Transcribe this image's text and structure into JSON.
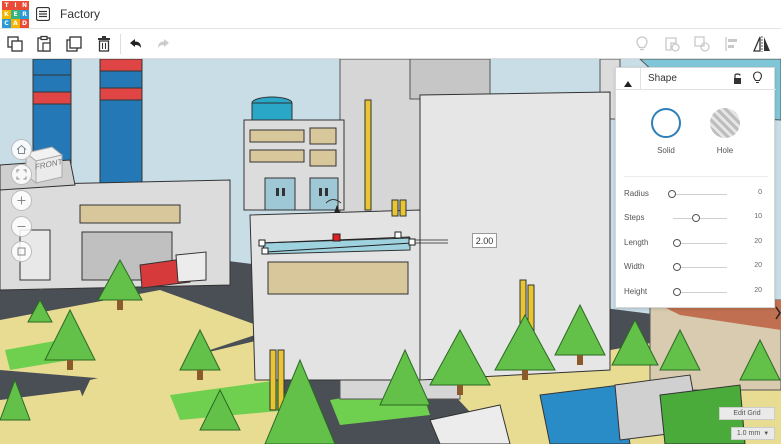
{
  "app": {
    "logo_letters": [
      "T",
      "I",
      "N",
      "K",
      "E",
      "R",
      "C",
      "A",
      "D"
    ],
    "logo_colors": [
      "#e94b36",
      "#e94b36",
      "#e94b36",
      "#f4b400",
      "#36b37e",
      "#2a9bd6",
      "#2a9bd6",
      "#f4b400",
      "#e94b36"
    ],
    "project_title": "Factory"
  },
  "toolbar": {
    "left_icons": [
      "copy-icon",
      "paste-icon",
      "duplicate-icon",
      "delete-icon",
      "undo-icon",
      "redo-icon"
    ],
    "right_icons": [
      "lightbulb-icon",
      "group-shapes-icon",
      "ungroup-icon",
      "align-icon",
      "mirror-icon"
    ]
  },
  "viewport": {
    "viewcube_label": "FRONT",
    "dimension_value": "2.00"
  },
  "shape_panel": {
    "title": "Shape",
    "solid_label": "Solid",
    "hole_label": "Hole",
    "solid_color": "#2f7fb8",
    "params": [
      {
        "label": "Radius",
        "value": "0",
        "level": 0.0
      },
      {
        "label": "Steps",
        "value": "10",
        "level": 0.45
      },
      {
        "label": "Length",
        "value": "20",
        "level": 0.1
      },
      {
        "label": "Width",
        "value": "20",
        "level": 0.1
      },
      {
        "label": "Height",
        "value": "20",
        "level": 0.1
      }
    ]
  },
  "footer": {
    "edit_grid_label": "Edit Grid",
    "snap_grid_label": "1.0 mm"
  }
}
